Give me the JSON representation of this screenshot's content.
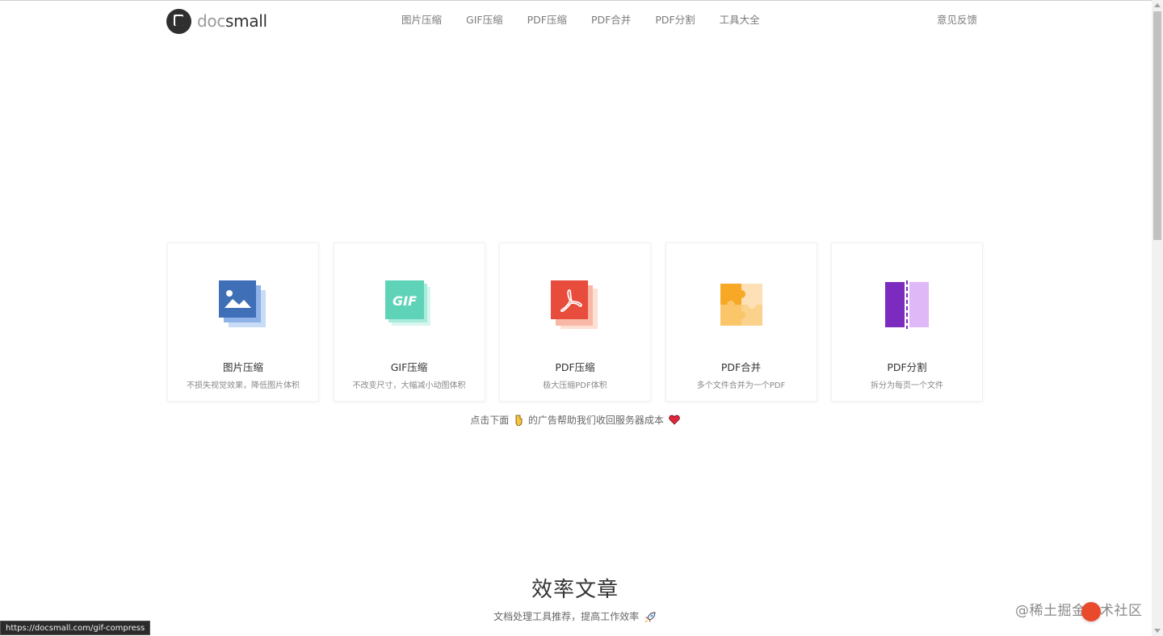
{
  "header": {
    "logo": {
      "part1": "doc",
      "part2": "small"
    },
    "nav": [
      {
        "label": "图片压缩"
      },
      {
        "label": "GIF压缩"
      },
      {
        "label": "PDF压缩"
      },
      {
        "label": "PDF合并"
      },
      {
        "label": "PDF分割"
      },
      {
        "label": "工具大全"
      }
    ],
    "feedback": "意见反馈"
  },
  "tools": [
    {
      "title": "图片压缩",
      "desc": "不损失视觉效果，降低图片体积",
      "icon": "image-icon",
      "color": "#3f6fb6"
    },
    {
      "title": "GIF压缩",
      "desc": "不改变尺寸，大幅减小动图体积",
      "icon": "gif-icon",
      "icon_text": "GIF",
      "color": "#5fd3b8"
    },
    {
      "title": "PDF压缩",
      "desc": "极大压缩PDF体积",
      "icon": "pdf-icon",
      "color": "#e74c3c"
    },
    {
      "title": "PDF合并",
      "desc": "多个文件合并为一个PDF",
      "icon": "puzzle-icon",
      "color": "#f7a825"
    },
    {
      "title": "PDF分割",
      "desc": "拆分为每页一个文件",
      "icon": "split-icon",
      "color": "#7b2cbf"
    }
  ],
  "ad_note": {
    "before": "点击下面",
    "after": "的广告帮助我们收回服务器成本"
  },
  "articles": {
    "title": "效率文章",
    "subtitle": "文档处理工具推荐，提高工作效率"
  },
  "status_url": "https://docsmall.com/gif-compress",
  "watermark": "@稀土掘金技术社区"
}
